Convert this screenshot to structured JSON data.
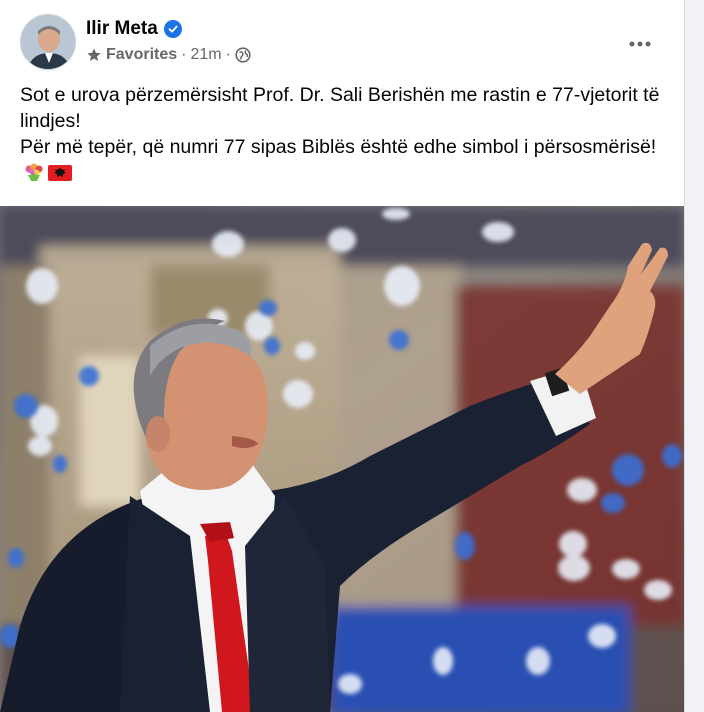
{
  "post": {
    "author": "Ilir Meta",
    "verified": true,
    "audience_label": "Favorites",
    "separator": "·",
    "timestamp": "21m",
    "privacy_icon": "globe-icon",
    "more_icon": "more-options-icon",
    "text_lines": [
      "Sot e urova përzemërsisht Prof. Dr. Sali Berishën me rastin e 77-vjetorit të lindjes!",
      "Për më tepër, që numri 77 sipas Biblës është edhe simbol i përsosmërisë!"
    ],
    "emojis": [
      "flower-bouquet-emoji",
      "albania-flag-emoji"
    ]
  },
  "colors": {
    "brand_blue": "#1b74e4",
    "text_primary": "#050505",
    "text_secondary": "#65676b",
    "confetti_blue": "#3b6fd6",
    "tie_red": "#d0171e"
  }
}
